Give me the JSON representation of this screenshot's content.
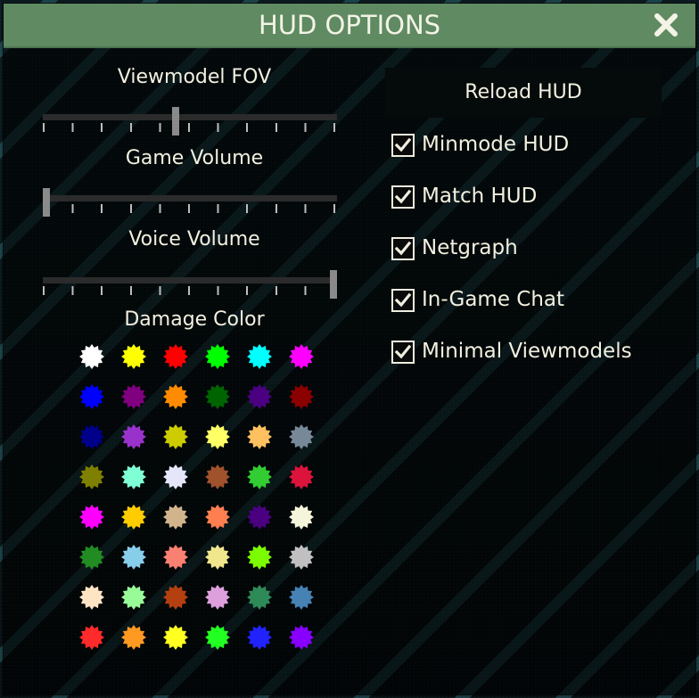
{
  "window": {
    "title": "HUD OPTIONS"
  },
  "sliders": [
    {
      "label": "Viewmodel FOV",
      "value_fraction": 0.45
    },
    {
      "label": "Game Volume",
      "value_fraction": 0.0
    },
    {
      "label": "Voice Volume",
      "value_fraction": 1.0
    }
  ],
  "damage_color": {
    "label": "Damage Color"
  },
  "reload_button": {
    "label": "Reload HUD"
  },
  "checkboxes": [
    {
      "label": "Minmode HUD",
      "checked": true
    },
    {
      "label": "Match HUD",
      "checked": true
    },
    {
      "label": "Netgraph",
      "checked": true
    },
    {
      "label": "In-Game Chat",
      "checked": true
    },
    {
      "label": "Minimal Viewmodels",
      "checked": true
    }
  ],
  "colors": {
    "title_bar": "#5f8a62",
    "text": "#f2f0e0",
    "stripe_accent": "#5ad2e1",
    "palette": [
      [
        "#ffffff",
        "#ffff00",
        "#ff0000",
        "#00ff00",
        "#00ffff",
        "#ff00ff"
      ],
      [
        "#0000ff",
        "#800080",
        "#ff8c00",
        "#006400",
        "#4b0082",
        "#8b0000"
      ],
      [
        "#00008b",
        "#9932cc",
        "#cccc00",
        "#ffff66",
        "#ffc060",
        "#778899"
      ],
      [
        "#808000",
        "#7fffd4",
        "#e6e6fa",
        "#a0522d",
        "#32cd32",
        "#dc143c"
      ],
      [
        "#ff00ff",
        "#ffcc00",
        "#d2b48c",
        "#ff7f50",
        "#4b0082",
        "#f5f5dc"
      ],
      [
        "#228b22",
        "#87ceeb",
        "#fa8072",
        "#f0e68c",
        "#7cfc00",
        "#c0c0c0"
      ],
      [
        "#ffe4c4",
        "#98fb98",
        "#b5400f",
        "#dda0dd",
        "#2e8b57",
        "#4682b4"
      ],
      [
        "#ff2a2a",
        "#ff9922",
        "#ffff22",
        "#22ff22",
        "#2222ff",
        "#8800ff"
      ]
    ]
  }
}
